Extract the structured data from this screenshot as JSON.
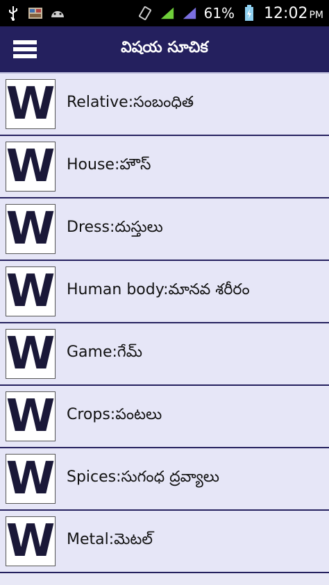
{
  "statusbar": {
    "icons": [
      "usb-icon",
      "notification-icon",
      "android-icon",
      "vibrate-icon",
      "signal-icon",
      "signal-icon"
    ],
    "battery_percent": "61%",
    "time": "12:02",
    "ampm": "PM"
  },
  "appbar": {
    "title": "విషయ సూచిక",
    "background": "#24205e"
  },
  "list": {
    "items": [
      {
        "icon": "W",
        "label": "Relative:సంబంధిత"
      },
      {
        "icon": "W",
        "label": "House:హౌస్"
      },
      {
        "icon": "W",
        "label": "Dress:దుస్తులు"
      },
      {
        "icon": "W",
        "label": "Human body:మానవ శరీరం"
      },
      {
        "icon": "W",
        "label": "Game:గేమ్"
      },
      {
        "icon": "W",
        "label": "Crops:పంటలు"
      },
      {
        "icon": "W",
        "label": "Spices:సుగంధ ద్రవ్యాలు"
      },
      {
        "icon": "W",
        "label": "Metal:మెటల్"
      }
    ]
  }
}
